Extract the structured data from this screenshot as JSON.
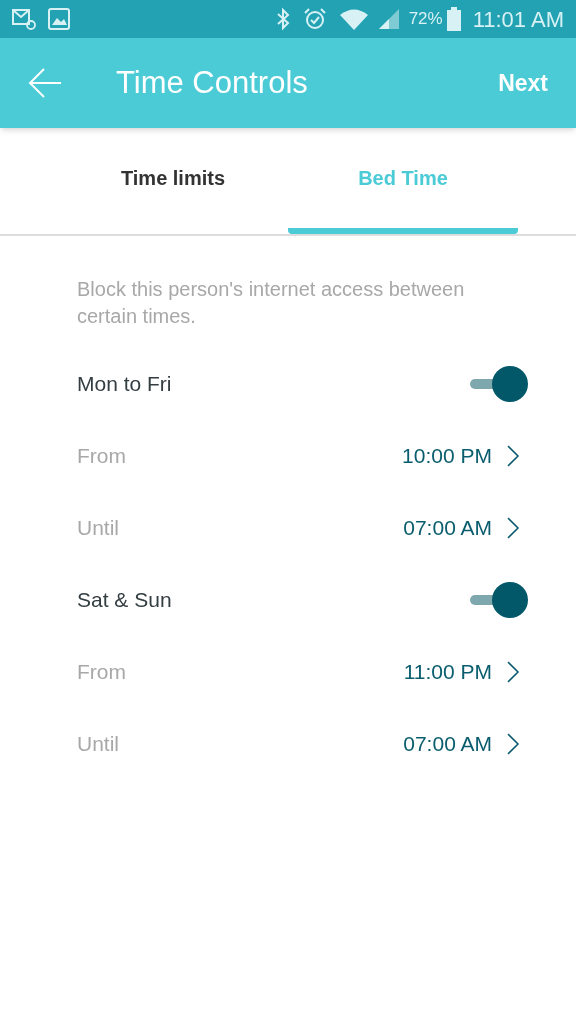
{
  "status_bar": {
    "battery": "72%",
    "time": "11:01 AM"
  },
  "app_bar": {
    "title": "Time Controls",
    "action": "Next"
  },
  "tabs": [
    {
      "label": "Time limits",
      "selected": false
    },
    {
      "label": "Bed Time",
      "selected": true
    }
  ],
  "description": "Block this person's internet access between certain times.",
  "schedules": [
    {
      "label": "Mon to Fri",
      "on": true,
      "times": [
        {
          "label": "From",
          "value": "10:00 PM"
        },
        {
          "label": "Until",
          "value": "07:00 AM"
        }
      ]
    },
    {
      "label": "Sat & Sun",
      "on": true,
      "times": [
        {
          "label": "From",
          "value": "11:00 PM"
        },
        {
          "label": "Until",
          "value": "07:00 AM"
        }
      ]
    }
  ]
}
